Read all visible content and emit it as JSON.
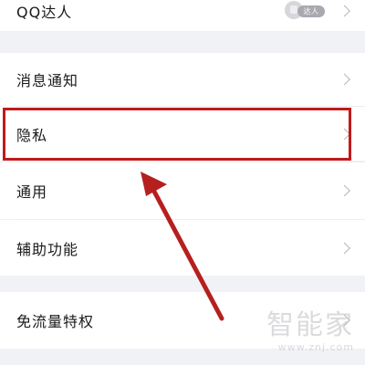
{
  "settings_items": [
    {
      "label": "QQ达人"
    },
    {
      "label": "消息通知"
    },
    {
      "label": "隐私"
    },
    {
      "label": "通用"
    },
    {
      "label": "辅助功能"
    },
    {
      "label": "免流量特权"
    }
  ],
  "badge_text": "达人",
  "watermark": {
    "main": "智能家",
    "url": "www.znj.com"
  },
  "colors": {
    "background": "#f1f2f6",
    "row": "#ffffff",
    "text": "#1a1a1a",
    "highlight": "#c0191c"
  },
  "icons": {
    "row_chevron": "chevron-right-icon",
    "badge": "daren-medal-icon",
    "pointer": "arrow-annotation"
  }
}
